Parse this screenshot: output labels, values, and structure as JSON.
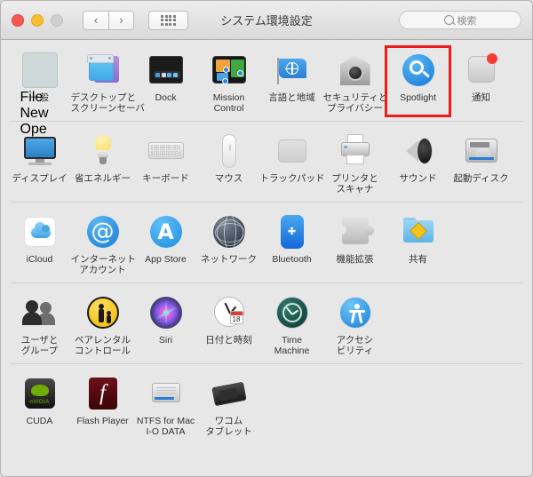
{
  "window": {
    "title": "システム環境設定",
    "traffic_lights": [
      "close",
      "minimize",
      "zoom"
    ],
    "nav": {
      "back": "‹",
      "forward": "›",
      "show_all": "grid-icon"
    },
    "search": {
      "placeholder": "検索",
      "value": ""
    }
  },
  "accent": {
    "highlight": "#ee1c1c",
    "badge": "#fa3b30"
  },
  "rows": [
    {
      "name": "personal",
      "items": [
        {
          "label": "一般",
          "icon": "general-icon",
          "selected": false,
          "badge": false
        },
        {
          "label": "デスクトップと\nスクリーンセーバ",
          "icon": "desktop-screensaver-icon",
          "selected": false,
          "badge": false
        },
        {
          "label": "Dock",
          "icon": "dock-icon",
          "selected": false,
          "badge": false
        },
        {
          "label": "Mission\nControl",
          "icon": "mission-control-icon",
          "selected": false,
          "badge": false
        },
        {
          "label": "言語と地域",
          "icon": "language-region-icon",
          "selected": false,
          "badge": false
        },
        {
          "label": "セキュリティと\nプライバシー",
          "icon": "security-privacy-icon",
          "selected": false,
          "badge": false
        },
        {
          "label": "Spotlight",
          "icon": "spotlight-icon",
          "selected": true,
          "badge": false
        },
        {
          "label": "通知",
          "icon": "notifications-icon",
          "selected": false,
          "badge": true
        }
      ]
    },
    {
      "name": "hardware",
      "items": [
        {
          "label": "ディスプレイ",
          "icon": "displays-icon",
          "selected": false,
          "badge": false
        },
        {
          "label": "省エネルギー",
          "icon": "energy-saver-icon",
          "selected": false,
          "badge": false
        },
        {
          "label": "キーボード",
          "icon": "keyboard-icon",
          "selected": false,
          "badge": false
        },
        {
          "label": "マウス",
          "icon": "mouse-icon",
          "selected": false,
          "badge": false
        },
        {
          "label": "トラックパッド",
          "icon": "trackpad-icon",
          "selected": false,
          "badge": false
        },
        {
          "label": "プリンタと\nスキャナ",
          "icon": "printers-scanners-icon",
          "selected": false,
          "badge": false
        },
        {
          "label": "サウンド",
          "icon": "sound-icon",
          "selected": false,
          "badge": false
        },
        {
          "label": "起動ディスク",
          "icon": "startup-disk-icon",
          "selected": false,
          "badge": false
        }
      ]
    },
    {
      "name": "internet-wireless",
      "items": [
        {
          "label": "iCloud",
          "icon": "icloud-icon",
          "selected": false,
          "badge": false
        },
        {
          "label": "インターネット\nアカウント",
          "icon": "internet-accounts-icon",
          "selected": false,
          "badge": false
        },
        {
          "label": "App Store",
          "icon": "app-store-icon",
          "selected": false,
          "badge": false
        },
        {
          "label": "ネットワーク",
          "icon": "network-icon",
          "selected": false,
          "badge": false
        },
        {
          "label": "Bluetooth",
          "icon": "bluetooth-icon",
          "selected": false,
          "badge": false
        },
        {
          "label": "機能拡張",
          "icon": "extensions-icon",
          "selected": false,
          "badge": false
        },
        {
          "label": "共有",
          "icon": "sharing-icon",
          "selected": false,
          "badge": false
        }
      ]
    },
    {
      "name": "system",
      "items": [
        {
          "label": "ユーザと\nグループ",
          "icon": "users-groups-icon",
          "selected": false,
          "badge": false
        },
        {
          "label": "ペアレンタル\nコントロール",
          "icon": "parental-controls-icon",
          "selected": false,
          "badge": false
        },
        {
          "label": "Siri",
          "icon": "siri-icon",
          "selected": false,
          "badge": false
        },
        {
          "label": "日付と時刻",
          "icon": "date-time-icon",
          "selected": false,
          "badge": false
        },
        {
          "label": "Time\nMachine",
          "icon": "time-machine-icon",
          "selected": false,
          "badge": false
        },
        {
          "label": "アクセシ\nビリティ",
          "icon": "accessibility-icon",
          "selected": false,
          "badge": false
        }
      ]
    },
    {
      "name": "third-party",
      "items": [
        {
          "label": "CUDA",
          "icon": "cuda-icon",
          "selected": false,
          "badge": false
        },
        {
          "label": "Flash Player",
          "icon": "flash-player-icon",
          "selected": false,
          "badge": false
        },
        {
          "label": "NTFS for Mac\nI-O DATA",
          "icon": "ntfs-for-mac-icon",
          "selected": false,
          "badge": false
        },
        {
          "label": "ワコム タブレット",
          "icon": "wacom-tablet-icon",
          "selected": false,
          "badge": false
        }
      ]
    }
  ],
  "date_icon_day": "18"
}
